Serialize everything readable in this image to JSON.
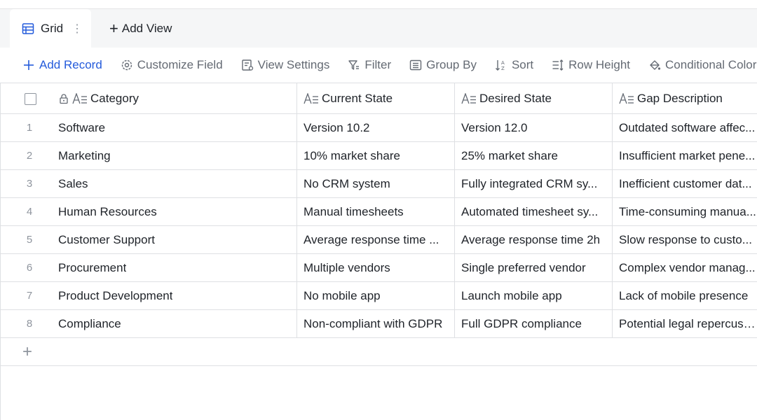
{
  "views": {
    "active_tab": "Grid",
    "add_view": "Add View"
  },
  "toolbar": {
    "add_record": "Add Record",
    "customize_field": "Customize Field",
    "view_settings": "View Settings",
    "filter": "Filter",
    "group_by": "Group By",
    "sort": "Sort",
    "row_height": "Row Height",
    "conditional_color": "Conditional Color"
  },
  "columns": [
    "Category",
    "Current State",
    "Desired State",
    "Gap Description"
  ],
  "rows": [
    {
      "n": "1",
      "category": "Software",
      "current": "Version 10.2",
      "desired": "Version 12.0",
      "gap": "Outdated software affec..."
    },
    {
      "n": "2",
      "category": "Marketing",
      "current": "10% market share",
      "desired": "25% market share",
      "gap": "Insufficient market pene..."
    },
    {
      "n": "3",
      "category": "Sales",
      "current": "No CRM system",
      "desired": "Fully integrated CRM sy...",
      "gap": "Inefficient customer dat..."
    },
    {
      "n": "4",
      "category": "Human Resources",
      "current": "Manual timesheets",
      "desired": "Automated timesheet sy...",
      "gap": "Time-consuming manua..."
    },
    {
      "n": "5",
      "category": "Customer Support",
      "current": "Average response time ...",
      "desired": "Average response time 2h",
      "gap": "Slow response to custo..."
    },
    {
      "n": "6",
      "category": "Procurement",
      "current": "Multiple vendors",
      "desired": "Single preferred vendor",
      "gap": "Complex vendor manag..."
    },
    {
      "n": "7",
      "category": "Product Development",
      "current": "No mobile app",
      "desired": "Launch mobile app",
      "gap": "Lack of mobile presence"
    },
    {
      "n": "8",
      "category": "Compliance",
      "current": "Non-compliant with GDPR",
      "desired": "Full GDPR compliance",
      "gap": "Potential legal repercuss..."
    }
  ],
  "colors": {
    "accent": "#245bdb",
    "border": "#dee0e3",
    "muted": "#646a73"
  }
}
